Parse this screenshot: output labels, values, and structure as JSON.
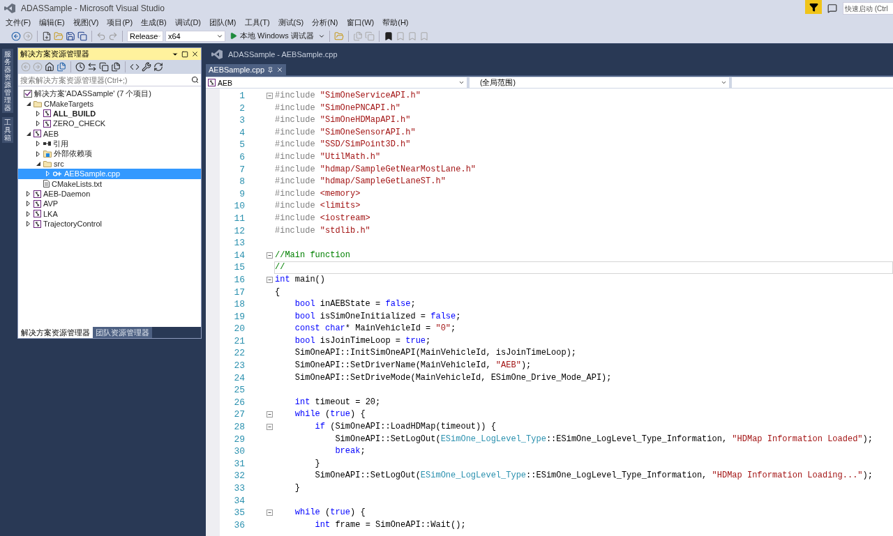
{
  "window": {
    "title": "ADASSample - Microsoft Visual Studio",
    "quick_launch": {
      "placeholder": "快速启动 (Ctrl"
    }
  },
  "menu": [
    "文件(F)",
    "编辑(E)",
    "视图(V)",
    "项目(P)",
    "生成(B)",
    "调试(D)",
    "团队(M)",
    "工具(T)",
    "测试(S)",
    "分析(N)",
    "窗口(W)",
    "帮助(H)"
  ],
  "toolbar": {
    "configuration": "Release",
    "platform": "x64",
    "debugger": "本地 Windows 调试器"
  },
  "side_tabs": [
    "服务器资源管理器",
    "工具箱"
  ],
  "solution_explorer": {
    "title": "解决方案资源管理器",
    "search": {
      "placeholder": "搜索解决方案资源管理器(Ctrl+;)"
    },
    "tree": {
      "root": "解决方案'ADASSample' (7 个项目)",
      "items": [
        {
          "label": "CMakeTargets",
          "kind": "folder",
          "expandable": true,
          "expanded": true,
          "selected": false,
          "startup": false,
          "children": [
            {
              "label": "ALL_BUILD",
              "kind": "project",
              "expandable": true,
              "expanded": false,
              "selected": false,
              "startup": true
            },
            {
              "label": "ZERO_CHECK",
              "kind": "project",
              "expandable": true,
              "expanded": false,
              "selected": false,
              "startup": false
            }
          ]
        },
        {
          "label": "AEB",
          "kind": "project",
          "expandable": true,
          "expanded": true,
          "selected": false,
          "startup": false,
          "children": [
            {
              "label": "引用",
              "kind": "references",
              "expandable": true,
              "expanded": false,
              "selected": false,
              "startup": false
            },
            {
              "label": "外部依赖项",
              "kind": "external",
              "expandable": true,
              "expanded": false,
              "selected": false,
              "startup": false
            },
            {
              "label": "src",
              "kind": "folder",
              "expandable": true,
              "expanded": true,
              "selected": false,
              "startup": false,
              "children": [
                {
                  "label": "AEBSample.cpp",
                  "kind": "cpp",
                  "expandable": true,
                  "expanded": false,
                  "selected": true,
                  "startup": false
                }
              ]
            },
            {
              "label": "CMakeLists.txt",
              "kind": "file",
              "expandable": false,
              "selected": false,
              "startup": false
            }
          ]
        },
        {
          "label": "AEB-Daemon",
          "kind": "project",
          "expandable": true,
          "expanded": false,
          "selected": false,
          "startup": false
        },
        {
          "label": "AVP",
          "kind": "project",
          "expandable": true,
          "expanded": false,
          "selected": false,
          "startup": false
        },
        {
          "label": "LKA",
          "kind": "project",
          "expandable": true,
          "expanded": false,
          "selected": false,
          "startup": false
        },
        {
          "label": "TrajectoryControl",
          "kind": "project",
          "expandable": true,
          "expanded": false,
          "selected": false,
          "startup": false
        }
      ]
    },
    "tabs": [
      {
        "label": "解决方案资源管理器",
        "selected": true
      },
      {
        "label": "团队资源管理器",
        "selected": false
      }
    ]
  },
  "editor": {
    "caption": "ADASSample - AEBSample.cpp",
    "tabs": [
      {
        "label": "AEBSample.cpp",
        "selected": true
      }
    ],
    "navigation": {
      "project": "AEB",
      "scope": "(全局范围)"
    },
    "lines": [
      {
        "n": "1",
        "fold_start": true,
        "current": false,
        "tokens": [
          {
            "kind": "pp",
            "text": "#include "
          },
          {
            "kind": "str",
            "text": "\"SimOneServiceAPI.h\""
          }
        ]
      },
      {
        "n": "2",
        "fold_start": false,
        "current": false,
        "tokens": [
          {
            "kind": "pp",
            "text": "#include "
          },
          {
            "kind": "str",
            "text": "\"SimOnePNCAPI.h\""
          }
        ]
      },
      {
        "n": "3",
        "fold_start": false,
        "current": false,
        "tokens": [
          {
            "kind": "pp",
            "text": "#include "
          },
          {
            "kind": "str",
            "text": "\"SimOneHDMapAPI.h\""
          }
        ]
      },
      {
        "n": "4",
        "fold_start": false,
        "current": false,
        "tokens": [
          {
            "kind": "pp",
            "text": "#include "
          },
          {
            "kind": "str",
            "text": "\"SimOneSensorAPI.h\""
          }
        ]
      },
      {
        "n": "5",
        "fold_start": false,
        "current": false,
        "tokens": [
          {
            "kind": "pp",
            "text": "#include "
          },
          {
            "kind": "str",
            "text": "\"SSD/SimPoint3D.h\""
          }
        ]
      },
      {
        "n": "6",
        "fold_start": false,
        "current": false,
        "tokens": [
          {
            "kind": "pp",
            "text": "#include "
          },
          {
            "kind": "str",
            "text": "\"UtilMath.h\""
          }
        ]
      },
      {
        "n": "7",
        "fold_start": false,
        "current": false,
        "tokens": [
          {
            "kind": "pp",
            "text": "#include "
          },
          {
            "kind": "str",
            "text": "\"hdmap/SampleGetNearMostLane.h\""
          }
        ]
      },
      {
        "n": "8",
        "fold_start": false,
        "current": false,
        "tokens": [
          {
            "kind": "pp",
            "text": "#include "
          },
          {
            "kind": "str",
            "text": "\"hdmap/SampleGetLaneST.h\""
          }
        ]
      },
      {
        "n": "9",
        "fold_start": false,
        "current": false,
        "tokens": [
          {
            "kind": "pp",
            "text": "#include "
          },
          {
            "kind": "str",
            "text": "<memory>"
          }
        ]
      },
      {
        "n": "10",
        "fold_start": false,
        "current": false,
        "tokens": [
          {
            "kind": "pp",
            "text": "#include "
          },
          {
            "kind": "str",
            "text": "<limits>"
          }
        ]
      },
      {
        "n": "11",
        "fold_start": false,
        "current": false,
        "tokens": [
          {
            "kind": "pp",
            "text": "#include "
          },
          {
            "kind": "str",
            "text": "<iostream>"
          }
        ]
      },
      {
        "n": "12",
        "fold_start": false,
        "current": false,
        "tokens": [
          {
            "kind": "pp",
            "text": "#include "
          },
          {
            "kind": "str",
            "text": "\"stdlib.h\""
          }
        ]
      },
      {
        "n": "13",
        "fold_start": false,
        "current": false
      },
      {
        "n": "14",
        "fold_start": true,
        "current": false,
        "tokens": [
          {
            "kind": "cmt",
            "text": "//Main function"
          }
        ]
      },
      {
        "n": "15",
        "fold_start": false,
        "current": true,
        "tokens": [
          {
            "kind": "cmt",
            "text": "//"
          }
        ]
      },
      {
        "n": "16",
        "fold_start": true,
        "current": false,
        "tokens": [
          {
            "kind": "kw",
            "text": "int"
          },
          {
            "kind": "plain",
            "text": " main()"
          }
        ]
      },
      {
        "n": "17",
        "fold_start": false,
        "current": false,
        "tokens": [
          {
            "kind": "plain",
            "text": "{"
          }
        ]
      },
      {
        "n": "18",
        "fold_start": false,
        "current": false,
        "tokens": [
          {
            "kind": "kw",
            "text": "    bool"
          },
          {
            "kind": "plain",
            "text": " inAEBState = "
          },
          {
            "kind": "kw",
            "text": "false"
          },
          {
            "kind": "plain",
            "text": ";"
          }
        ]
      },
      {
        "n": "19",
        "fold_start": false,
        "current": false,
        "tokens": [
          {
            "kind": "kw",
            "text": "    bool"
          },
          {
            "kind": "plain",
            "text": " isSimOneInitialized = "
          },
          {
            "kind": "kw",
            "text": "false"
          },
          {
            "kind": "plain",
            "text": ";"
          }
        ]
      },
      {
        "n": "20",
        "fold_start": false,
        "current": false,
        "tokens": [
          {
            "kind": "kw",
            "text": "    const char"
          },
          {
            "kind": "plain",
            "text": "* MainVehicleId = "
          },
          {
            "kind": "str",
            "text": "\"0\""
          },
          {
            "kind": "plain",
            "text": ";"
          }
        ]
      },
      {
        "n": "21",
        "fold_start": false,
        "current": false,
        "tokens": [
          {
            "kind": "kw",
            "text": "    bool"
          },
          {
            "kind": "plain",
            "text": " isJoinTimeLoop = "
          },
          {
            "kind": "kw",
            "text": "true"
          },
          {
            "kind": "plain",
            "text": ";"
          }
        ]
      },
      {
        "n": "22",
        "fold_start": false,
        "current": false,
        "tokens": [
          {
            "kind": "plain",
            "text": "    SimOneAPI::InitSimOneAPI(MainVehicleId, isJoinTimeLoop);"
          }
        ]
      },
      {
        "n": "23",
        "fold_start": false,
        "current": false,
        "tokens": [
          {
            "kind": "plain",
            "text": "    SimOneAPI::SetDriverName(MainVehicleId, "
          },
          {
            "kind": "str",
            "text": "\"AEB\""
          },
          {
            "kind": "plain",
            "text": ");"
          }
        ]
      },
      {
        "n": "24",
        "fold_start": false,
        "current": false,
        "tokens": [
          {
            "kind": "plain",
            "text": "    SimOneAPI::SetDriveMode(MainVehicleId, ESimOne_Drive_Mode_API);"
          }
        ]
      },
      {
        "n": "25",
        "fold_start": false,
        "current": false
      },
      {
        "n": "26",
        "fold_start": false,
        "current": false,
        "tokens": [
          {
            "kind": "kw",
            "text": "    int"
          },
          {
            "kind": "plain",
            "text": " timeout = 20;"
          }
        ]
      },
      {
        "n": "27",
        "fold_start": true,
        "current": false,
        "tokens": [
          {
            "kind": "kw",
            "text": "    while"
          },
          {
            "kind": "plain",
            "text": " ("
          },
          {
            "kind": "kw",
            "text": "true"
          },
          {
            "kind": "plain",
            "text": ") {"
          }
        ]
      },
      {
        "n": "28",
        "fold_start": true,
        "current": false,
        "tokens": [
          {
            "kind": "kw",
            "text": "        if"
          },
          {
            "kind": "plain",
            "text": " (SimOneAPI::LoadHDMap(timeout)) {"
          }
        ]
      },
      {
        "n": "29",
        "fold_start": false,
        "current": false,
        "tokens": [
          {
            "kind": "plain",
            "text": "            SimOneAPI::SetLogOut("
          },
          {
            "kind": "type",
            "text": "ESimOne_LogLevel_Type"
          },
          {
            "kind": "plain",
            "text": "::ESimOne_LogLevel_Type_Information, "
          },
          {
            "kind": "str",
            "text": "\"HDMap Information Loaded\""
          },
          {
            "kind": "plain",
            "text": ");"
          }
        ]
      },
      {
        "n": "30",
        "fold_start": false,
        "current": false,
        "tokens": [
          {
            "kind": "kw",
            "text": "            break"
          },
          {
            "kind": "plain",
            "text": ";"
          }
        ]
      },
      {
        "n": "31",
        "fold_start": false,
        "current": false,
        "tokens": [
          {
            "kind": "plain",
            "text": "        }"
          }
        ]
      },
      {
        "n": "32",
        "fold_start": false,
        "current": false,
        "tokens": [
          {
            "kind": "plain",
            "text": "        SimOneAPI::SetLogOut("
          },
          {
            "kind": "type",
            "text": "ESimOne_LogLevel_Type"
          },
          {
            "kind": "plain",
            "text": "::ESimOne_LogLevel_Type_Information, "
          },
          {
            "kind": "str",
            "text": "\"HDMap Information Loading...\""
          },
          {
            "kind": "plain",
            "text": ");"
          }
        ]
      },
      {
        "n": "33",
        "fold_start": false,
        "current": false,
        "tokens": [
          {
            "kind": "plain",
            "text": "    }"
          }
        ]
      },
      {
        "n": "34",
        "fold_start": false,
        "current": false
      },
      {
        "n": "35",
        "fold_start": true,
        "current": false,
        "tokens": [
          {
            "kind": "kw",
            "text": "    while"
          },
          {
            "kind": "plain",
            "text": " ("
          },
          {
            "kind": "kw",
            "text": "true"
          },
          {
            "kind": "plain",
            "text": ") {"
          }
        ]
      },
      {
        "n": "36",
        "fold_start": false,
        "current": false,
        "tokens": [
          {
            "kind": "kw",
            "text": "        int"
          },
          {
            "kind": "plain",
            "text": " frame = SimOneAPI::Wait();"
          }
        ]
      }
    ]
  }
}
